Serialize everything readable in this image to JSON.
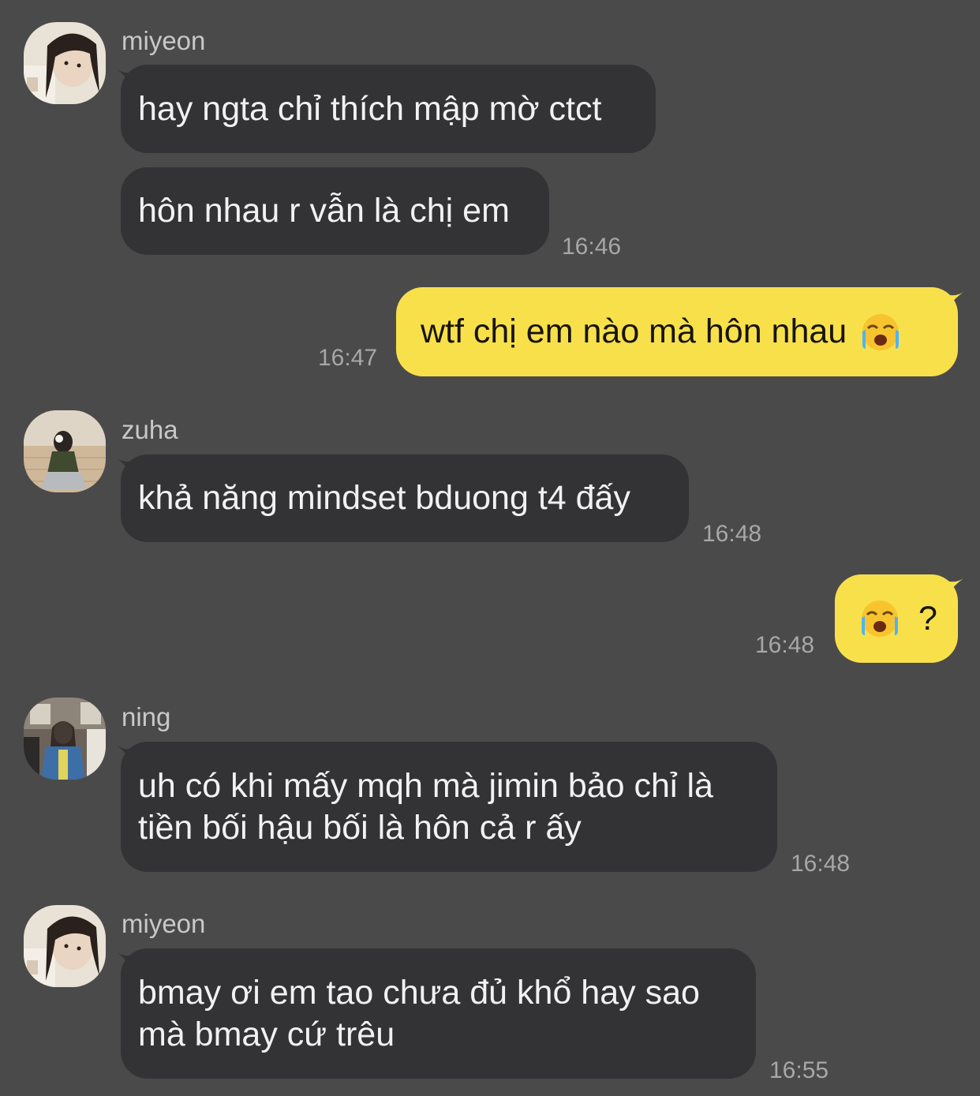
{
  "messages": [
    {
      "sender": "miyeon",
      "text": "hay ngta chỉ thích mập mờ ctct"
    },
    {
      "text": "hôn nhau r vẫn là chị em",
      "time": "16:46"
    },
    {
      "text": "wtf chị em nào mà hôn nhau",
      "time": "16:47",
      "emoji": "loudly-crying-face-emoji"
    },
    {
      "sender": "zuha",
      "text": "khả năng mindset bduong t4 đấy",
      "time": "16:48"
    },
    {
      "text": "?",
      "time": "16:48",
      "emoji": "loudly-crying-face-emoji"
    },
    {
      "sender": "ning",
      "line1": "uh có khi mấy mqh mà jimin bảo chỉ là",
      "line2": "tiền bối hậu bối là hôn cả r ấy",
      "time": "16:48"
    },
    {
      "sender": "miyeon",
      "line1": "bmay ơi em tao chưa đủ khổ hay sao",
      "line2": "mà bmay cứ trêu",
      "time": "16:55"
    }
  ],
  "colors": {
    "background": "#4b4a4b",
    "incoming_bubble": "#333234",
    "outgoing_bubble": "#f8e04b",
    "timestamp": "#a8a7a8",
    "sender_name": "#c9c8c9"
  }
}
